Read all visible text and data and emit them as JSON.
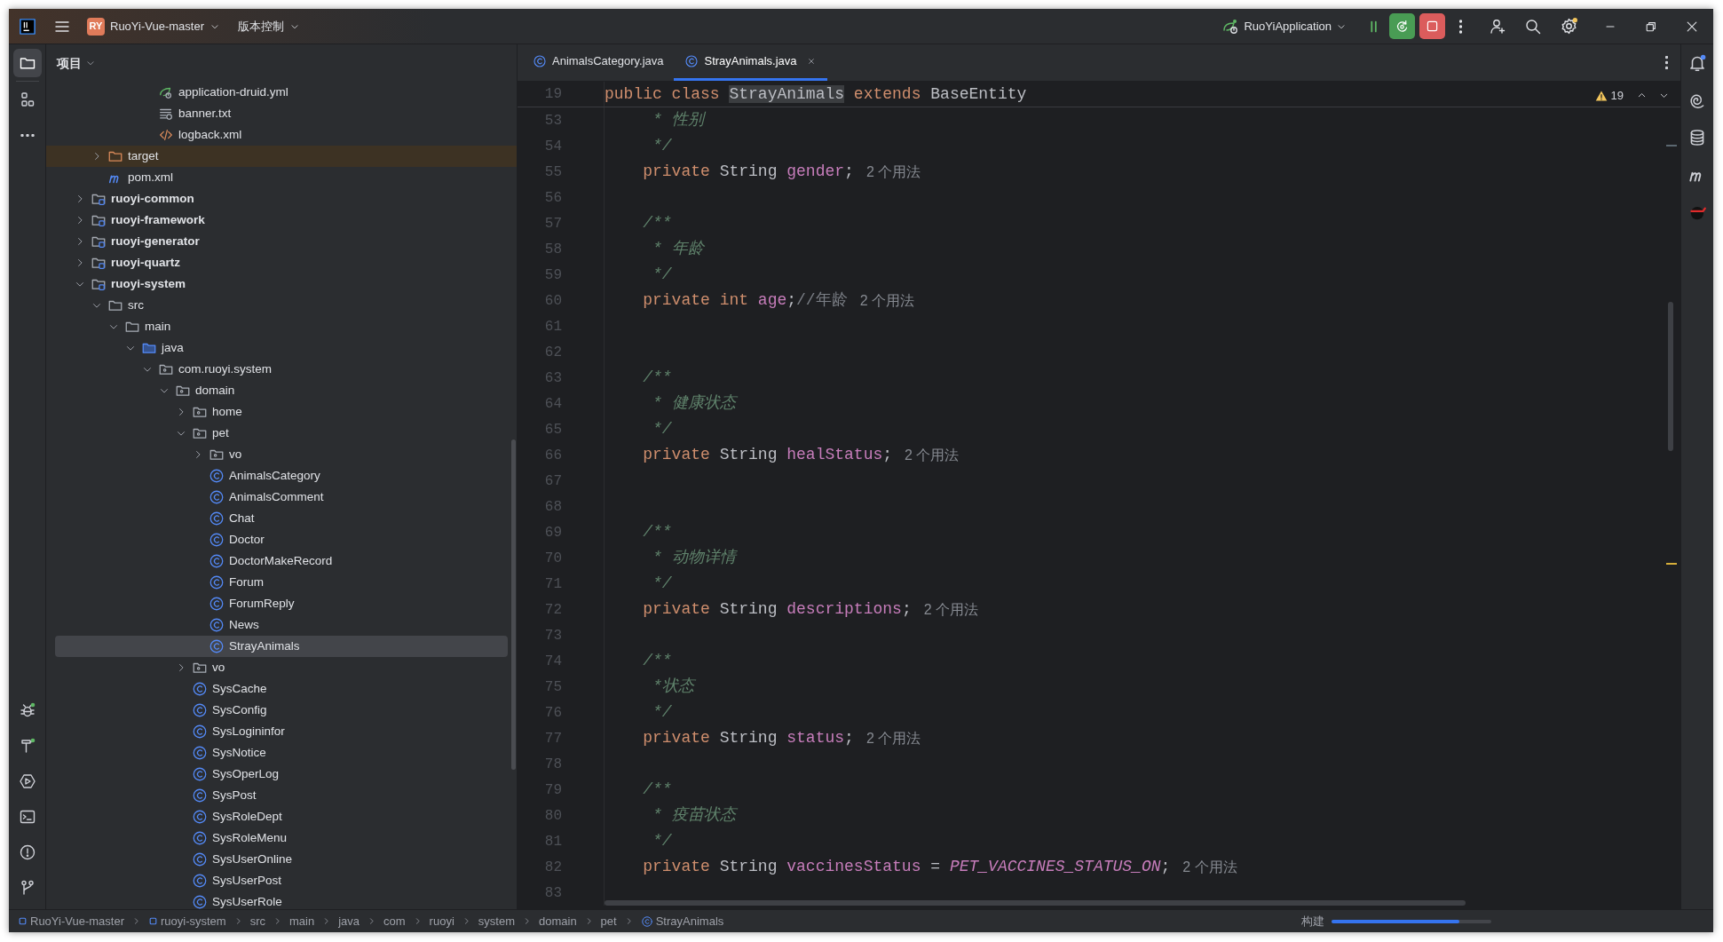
{
  "title_bar": {
    "project_badge": "RY",
    "project": "RuoYi-Vue-master",
    "vcs": "版本控制",
    "run_config": "RuoYiApplication"
  },
  "left_toolbar_top": [
    {
      "kind": "project",
      "selected": true
    },
    {
      "kind": "structure",
      "selected": false
    },
    {
      "kind": "more",
      "selected": false
    }
  ],
  "left_toolbar_bottom": [
    {
      "kind": "debug",
      "selected": false
    },
    {
      "kind": "build",
      "selected": false
    },
    {
      "kind": "services",
      "selected": false
    },
    {
      "kind": "terminal",
      "selected": false
    },
    {
      "kind": "problems",
      "selected": false
    },
    {
      "kind": "git",
      "selected": false
    }
  ],
  "right_toolbar": [
    {
      "kind": "notifications"
    },
    {
      "kind": "ai"
    },
    {
      "kind": "database"
    },
    {
      "kind": "maven"
    },
    {
      "kind": "plugin"
    }
  ],
  "project_panel": {
    "title": "项目",
    "tree": [
      {
        "children": [
          {
            "children": [
              {
                "children": [
                  {
                    "children": [
                      {
                        "label": "application-druid.yml",
                        "kind": "yml",
                        "selected": false
                      },
                      {
                        "label": "banner.txt",
                        "kind": "txt",
                        "selected": false
                      },
                      {
                        "label": "logback.xml",
                        "kind": "xml",
                        "selected": false
                      }
                    ]
                  }
                ]
              }
            ]
          },
          {
            "label": "target",
            "kind": "excluded_folder",
            "expanded": false,
            "selected": false
          },
          {
            "label": "pom.xml",
            "kind": "maven",
            "selected": false
          }
        ]
      },
      {
        "label": "ruoyi-common",
        "kind": "module",
        "expanded": false,
        "selected": false
      },
      {
        "label": "ruoyi-framework",
        "kind": "module",
        "expanded": false,
        "selected": false
      },
      {
        "label": "ruoyi-generator",
        "kind": "module",
        "expanded": false,
        "selected": false
      },
      {
        "label": "ruoyi-quartz",
        "kind": "module",
        "expanded": false,
        "selected": false
      },
      {
        "label": "ruoyi-system",
        "kind": "module",
        "expanded": true,
        "selected": false,
        "children": [
          {
            "label": "src",
            "kind": "folder",
            "expanded": true,
            "selected": false,
            "children": [
              {
                "label": "main",
                "kind": "folder",
                "expanded": true,
                "selected": false,
                "children": [
                  {
                    "label": "java",
                    "kind": "source_folder",
                    "expanded": true,
                    "selected": false,
                    "children": [
                      {
                        "label": "com.ruoyi.system",
                        "kind": "package",
                        "expanded": true,
                        "selected": false,
                        "children": [
                          {
                            "label": "domain",
                            "kind": "package",
                            "expanded": true,
                            "selected": false,
                            "children": [
                              {
                                "label": "home",
                                "kind": "package",
                                "expanded": false,
                                "selected": false
                              },
                              {
                                "label": "pet",
                                "kind": "package",
                                "expanded": true,
                                "selected": false,
                                "children": [
                                  {
                                    "label": "vo",
                                    "kind": "package",
                                    "expanded": false,
                                    "selected": false
                                  },
                                  {
                                    "label": "AnimalsCategory",
                                    "kind": "class",
                                    "selected": false
                                  },
                                  {
                                    "label": "AnimalsComment",
                                    "kind": "class",
                                    "selected": false
                                  },
                                  {
                                    "label": "Chat",
                                    "kind": "class",
                                    "selected": false
                                  },
                                  {
                                    "label": "Doctor",
                                    "kind": "class",
                                    "selected": false
                                  },
                                  {
                                    "label": "DoctorMakeRecord",
                                    "kind": "class",
                                    "selected": false
                                  },
                                  {
                                    "label": "Forum",
                                    "kind": "class",
                                    "selected": false
                                  },
                                  {
                                    "label": "ForumReply",
                                    "kind": "class",
                                    "selected": false
                                  },
                                  {
                                    "label": "News",
                                    "kind": "class",
                                    "selected": false
                                  },
                                  {
                                    "label": "StrayAnimals",
                                    "kind": "class",
                                    "selected": true
                                  }
                                ]
                              },
                              {
                                "label": "vo",
                                "kind": "package",
                                "expanded": false,
                                "selected": false
                              },
                              {
                                "label": "SysCache",
                                "kind": "class",
                                "selected": false
                              },
                              {
                                "label": "SysConfig",
                                "kind": "class",
                                "selected": false
                              },
                              {
                                "label": "SysLogininfor",
                                "kind": "class",
                                "selected": false
                              },
                              {
                                "label": "SysNotice",
                                "kind": "class",
                                "selected": false
                              },
                              {
                                "label": "SysOperLog",
                                "kind": "class",
                                "selected": false
                              },
                              {
                                "label": "SysPost",
                                "kind": "class",
                                "selected": false
                              },
                              {
                                "label": "SysRoleDept",
                                "kind": "class",
                                "selected": false
                              },
                              {
                                "label": "SysRoleMenu",
                                "kind": "class",
                                "selected": false
                              },
                              {
                                "label": "SysUserOnline",
                                "kind": "class",
                                "selected": false
                              },
                              {
                                "label": "SysUserPost",
                                "kind": "class",
                                "selected": false
                              },
                              {
                                "label": "SysUserRole",
                                "kind": "class",
                                "selected": false
                              }
                            ]
                          }
                        ]
                      }
                    ]
                  }
                ]
              }
            ]
          }
        ]
      }
    ]
  },
  "editor": {
    "tabs": [
      {
        "label": "AnimalsCategory.java",
        "selected": false
      },
      {
        "label": "StrayAnimals.java",
        "selected": true
      }
    ],
    "warnings": "19",
    "sticky_line": {
      "number": "19",
      "code": [
        {
          "text": "public class ",
          "kind": "keyword"
        },
        {
          "text": "StrayAnimals",
          "kind": "highlighted"
        },
        {
          "text": " extends ",
          "kind": "keyword"
        },
        {
          "text": "BaseEntity",
          "kind": "plain"
        }
      ]
    },
    "lines": [
      {
        "number": "53",
        "code": [
          {
            "text": "     * 性别",
            "kind": "doc"
          }
        ]
      },
      {
        "number": "54",
        "code": [
          {
            "text": "     */",
            "kind": "doc"
          }
        ]
      },
      {
        "number": "55",
        "code": [
          {
            "text": "    private ",
            "kind": "keyword"
          },
          {
            "text": "String ",
            "kind": "plain"
          },
          {
            "text": "gender",
            "kind": "field"
          },
          {
            "text": ";",
            "kind": "plain"
          }
        ],
        "hint": "2 个用法"
      },
      {
        "number": "56"
      },
      {
        "number": "57",
        "code": [
          {
            "text": "    /**",
            "kind": "doc"
          }
        ]
      },
      {
        "number": "58",
        "code": [
          {
            "text": "     * 年龄",
            "kind": "doc"
          }
        ]
      },
      {
        "number": "59",
        "code": [
          {
            "text": "     */",
            "kind": "doc"
          }
        ]
      },
      {
        "number": "60",
        "code": [
          {
            "text": "    private ",
            "kind": "keyword"
          },
          {
            "text": "int ",
            "kind": "keyword"
          },
          {
            "text": "age",
            "kind": "field"
          },
          {
            "text": ";",
            "kind": "plain"
          },
          {
            "text": "//年龄",
            "kind": "comment"
          }
        ],
        "hint": "2 个用法"
      },
      {
        "number": "61"
      },
      {
        "number": "62"
      },
      {
        "number": "63",
        "code": [
          {
            "text": "    /**",
            "kind": "doc"
          }
        ]
      },
      {
        "number": "64",
        "code": [
          {
            "text": "     * 健康状态",
            "kind": "doc"
          }
        ]
      },
      {
        "number": "65",
        "code": [
          {
            "text": "     */",
            "kind": "doc"
          }
        ]
      },
      {
        "number": "66",
        "code": [
          {
            "text": "    private ",
            "kind": "keyword"
          },
          {
            "text": "String ",
            "kind": "plain"
          },
          {
            "text": "healStatus",
            "kind": "field"
          },
          {
            "text": ";",
            "kind": "plain"
          }
        ],
        "hint": "2 个用法"
      },
      {
        "number": "67"
      },
      {
        "number": "68"
      },
      {
        "number": "69",
        "code": [
          {
            "text": "    /**",
            "kind": "doc"
          }
        ]
      },
      {
        "number": "70",
        "code": [
          {
            "text": "     * 动物详情",
            "kind": "doc"
          }
        ]
      },
      {
        "number": "71",
        "code": [
          {
            "text": "     */",
            "kind": "doc"
          }
        ]
      },
      {
        "number": "72",
        "code": [
          {
            "text": "    private ",
            "kind": "keyword"
          },
          {
            "text": "String ",
            "kind": "plain"
          },
          {
            "text": "descriptions",
            "kind": "field"
          },
          {
            "text": ";",
            "kind": "plain"
          }
        ],
        "hint": "2 个用法"
      },
      {
        "number": "73"
      },
      {
        "number": "74",
        "code": [
          {
            "text": "    /**",
            "kind": "doc"
          }
        ]
      },
      {
        "number": "75",
        "code": [
          {
            "text": "     *状态",
            "kind": "doc"
          }
        ]
      },
      {
        "number": "76",
        "code": [
          {
            "text": "     */",
            "kind": "doc"
          }
        ]
      },
      {
        "number": "77",
        "code": [
          {
            "text": "    private ",
            "kind": "keyword"
          },
          {
            "text": "String ",
            "kind": "plain"
          },
          {
            "text": "status",
            "kind": "field"
          },
          {
            "text": ";",
            "kind": "plain"
          }
        ],
        "hint": "2 个用法"
      },
      {
        "number": "78"
      },
      {
        "number": "79",
        "code": [
          {
            "text": "    /**",
            "kind": "doc"
          }
        ]
      },
      {
        "number": "80",
        "code": [
          {
            "text": "     * 疫苗状态",
            "kind": "doc"
          }
        ]
      },
      {
        "number": "81",
        "code": [
          {
            "text": "     */",
            "kind": "doc"
          }
        ]
      },
      {
        "number": "82",
        "code": [
          {
            "text": "    private ",
            "kind": "keyword"
          },
          {
            "text": "String ",
            "kind": "plain"
          },
          {
            "text": "vaccinesStatus",
            "kind": "field"
          },
          {
            "text": " = ",
            "kind": "plain"
          },
          {
            "text": "PET_VACCINES_STATUS_ON",
            "kind": "constant"
          },
          {
            "text": ";",
            "kind": "plain"
          }
        ],
        "hint": "2 个用法"
      },
      {
        "number": "83"
      }
    ]
  },
  "status_bar": {
    "breadcrumbs": [
      {
        "label": "RuoYi-Vue-master",
        "kind": "module"
      },
      {
        "label": "ruoyi-system",
        "kind": "module"
      },
      {
        "label": "src",
        "kind": "folder"
      },
      {
        "label": "main",
        "kind": "folder"
      },
      {
        "label": "java",
        "kind": "folder"
      },
      {
        "label": "com",
        "kind": "folder"
      },
      {
        "label": "ruoyi",
        "kind": "folder"
      },
      {
        "label": "system",
        "kind": "folder"
      },
      {
        "label": "domain",
        "kind": "folder"
      },
      {
        "label": "pet",
        "kind": "folder"
      },
      {
        "label": "StrayAnimals",
        "kind": "class"
      }
    ],
    "build_label": "构建",
    "build_progress": {
      "level": 0.8
    }
  }
}
